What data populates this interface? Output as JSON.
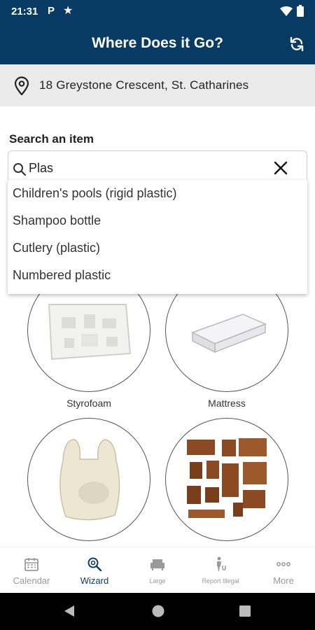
{
  "status_bar": {
    "time": "21:31",
    "p_glyph": "P",
    "icons": [
      "parking-icon",
      "star-icon",
      "wifi-icon",
      "battery-icon"
    ]
  },
  "app_bar": {
    "title": "Where Does it Go?",
    "icons": [
      "refresh-icon"
    ]
  },
  "address": {
    "text": "18 Greystone Crescent, St. Catharines",
    "icon": "location-pin-icon"
  },
  "search": {
    "label": "Search an item",
    "value": "Plas",
    "icons": [
      "search-icon",
      "close-icon"
    ]
  },
  "suggestions": [
    "Children's pools (rigid plastic)",
    "Shampoo bottle",
    "Cutlery (plastic)",
    "Numbered plastic"
  ],
  "tiles": [
    {
      "label": "Styrofoam",
      "image": "styrofoam-image"
    },
    {
      "label": "Mattress",
      "image": "mattress-image"
    },
    {
      "label": "",
      "image": "plastic-bag-image"
    },
    {
      "label": "",
      "image": "furniture-image"
    }
  ],
  "bottom_nav": [
    {
      "label": "Calendar",
      "icon": "calendar-icon",
      "active": false
    },
    {
      "label": "Wizard",
      "icon": "wizard-search-icon",
      "active": true
    },
    {
      "label": "Large",
      "icon": "couch-icon",
      "active": false
    },
    {
      "label": "Report Illegal",
      "icon": "report-person-icon",
      "active": false
    },
    {
      "label": "More",
      "icon": "more-dots-icon",
      "active": false
    }
  ],
  "system_nav": [
    "back-icon",
    "home-icon",
    "recents-icon"
  ],
  "colors": {
    "primary": "#073b63",
    "address_bg": "#ebebeb",
    "nav_inactive": "#999999",
    "nav_active": "#0d3c67"
  }
}
